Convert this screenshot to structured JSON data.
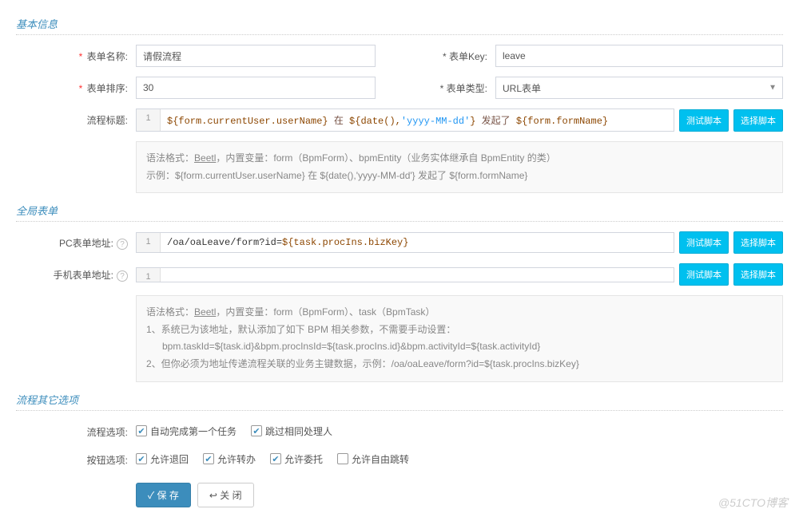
{
  "sections": {
    "basic": "基本信息",
    "global": "全局表单",
    "other": "流程其它选项"
  },
  "labels": {
    "formName": "表单名称:",
    "formKey": "表单Key:",
    "formSort": "表单排序:",
    "formType": "表单类型:",
    "procTitle": "流程标题:",
    "pcFormUrl": "PC表单地址:",
    "mobileFormUrl": "手机表单地址:",
    "procOption": "流程选项:",
    "btnOption": "按钮选项:"
  },
  "values": {
    "formName": "请假流程",
    "formKey": "leave",
    "formSort": "30",
    "formType": "URL表单",
    "gutter": "1"
  },
  "code": {
    "procTitle_parts": {
      "p1": "${form.currentUser.userName}",
      "p2": " 在 ",
      "p3": "${date(),",
      "p4": "'yyyy-MM-dd'",
      "p5": "}",
      "p6": " 发起了 ",
      "p7": "${form.formName}"
    },
    "pcUrl_parts": {
      "p1": "/oa/oaLeave/form?id=",
      "p2": "${task.procIns.bizKey}"
    }
  },
  "buttons": {
    "testScript": "测试脚本",
    "selectScript": "选择脚本",
    "save": "保 存",
    "close": "关 闭"
  },
  "help": {
    "basic_l1a": "语法格式：",
    "basic_l1b": "Beetl",
    "basic_l1c": "，内置变量：form（BpmForm）、bpmEntity（业务实体继承自 BpmEntity 的类）",
    "basic_l2": "示例：${form.currentUser.userName} 在 ${date(),'yyyy-MM-dd'} 发起了 ${form.formName}",
    "global_l1a": "语法格式：",
    "global_l1b": "Beetl",
    "global_l1c": "，内置变量：form（BpmForm）、task（BpmTask）",
    "global_l2": "1、系统已为该地址，默认添加了如下 BPM 相关参数，不需要手动设置：",
    "global_l3": "      bpm.taskId=${task.id}&bpm.procInsId=${task.procIns.id}&bpm.activityId=${task.activityId}",
    "global_l4": "2、但你必须为地址传递流程关联的业务主键数据，示例：/oa/oaLeave/form?id=${task.procIns.bizKey}"
  },
  "options": {
    "proc": [
      {
        "label": "自动完成第一个任务",
        "checked": true
      },
      {
        "label": "跳过相同处理人",
        "checked": true
      }
    ],
    "btn": [
      {
        "label": "允许退回",
        "checked": true
      },
      {
        "label": "允许转办",
        "checked": true
      },
      {
        "label": "允许委托",
        "checked": true
      },
      {
        "label": "允许自由跳转",
        "checked": false
      }
    ]
  },
  "icons": {
    "help": "?",
    "save": "✓",
    "close": "↩",
    "caret": "▼",
    "check": "✔"
  },
  "watermark": "@51CTO博客"
}
